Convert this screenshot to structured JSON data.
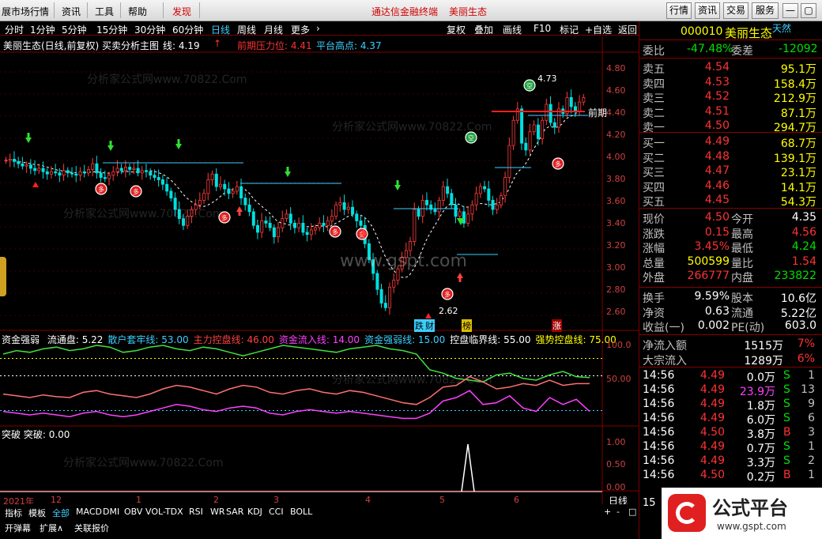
{
  "menu": {
    "items": [
      "展市场行情",
      "资讯",
      "工具",
      "帮助"
    ],
    "discover": "发现",
    "title_app": "通达信金融终端",
    "title_stock": "美丽生态",
    "right_buttons": [
      "行情",
      "资讯",
      "交易",
      "服务"
    ],
    "win_buttons": [
      "◯",
      "—",
      "▢",
      "✕"
    ]
  },
  "periods": {
    "items": [
      "分时",
      "1分钟",
      "5分钟",
      "15分钟",
      "30分钟",
      "60分钟",
      "日线",
      "周线",
      "月线",
      "更多",
      "›"
    ],
    "active": "日线",
    "tools": [
      "复权",
      "叠加",
      "画线",
      "F10",
      "标记",
      "+自选",
      "返回"
    ]
  },
  "chart_header": {
    "title": "美丽生态(日线,前复权) 买卖分析主图",
    "line_label": "线: 4.19",
    "line_arrow": "↑",
    "pressure": "前期压力位: 4.41",
    "platform": "平台高点: 4.37"
  },
  "indicator1": {
    "name": "资金强弱",
    "items": [
      {
        "label": "流通盘: 5.22",
        "color": "#ffffff"
      },
      {
        "label": "散户套牢线: 53.00",
        "color": "#3ccfff"
      },
      {
        "label": "主力控盘线: 46.00",
        "color": "#ff4040"
      },
      {
        "label": "资金流入线: 14.00",
        "color": "#ff40ff"
      },
      {
        "label": "资金强弱线: 15.00",
        "color": "#3ccfff"
      },
      {
        "label": "控盘临界线: 55.00",
        "color": "#ffffff"
      },
      {
        "label": "强势控盘线: 75.00",
        "color": "#ffff00"
      }
    ]
  },
  "indicator2": {
    "name": "突破",
    "value": "突破: 0.00"
  },
  "axis_main": [
    "4.80",
    "4.60",
    "4.40",
    "4.20",
    "4.00",
    "3.80",
    "3.60",
    "3.40",
    "3.20",
    "3.00",
    "2.80",
    "2.60"
  ],
  "axis_ind1": [
    "100.0",
    "50.00"
  ],
  "axis_ind2": [
    "1.00",
    "0.50",
    "0.00"
  ],
  "markers": {
    "high": "4.73",
    "low": "2.62",
    "front": "前期",
    "tags": [
      "跌",
      "财",
      "榜",
      "涨"
    ]
  },
  "time_axis": [
    "2021年",
    "12",
    "1",
    "2",
    "3",
    "4",
    "5",
    "6"
  ],
  "period_label": "日线",
  "bottom_tabs": [
    "指标",
    "模板",
    "全部",
    "MACD",
    "DMI",
    "OBV",
    "VOL-TDX",
    "RSI",
    "WR",
    "SAR",
    "KDJ",
    "CCI",
    "BOLL"
  ],
  "bottom_tabs_active": "全部",
  "bottom_row2": [
    "开弹幕",
    "扩展∧",
    "关联报价"
  ],
  "watermark": "分析家公式网www.70822.Com",
  "watermark2": "www.gspt.com",
  "quote": {
    "code": "000010",
    "name": "美丽生态",
    "tag": "天然",
    "weibi_label": "委比",
    "weibi": "-47.48%",
    "weicha_label": "委差",
    "weicha": "-12092",
    "sell": [
      {
        "label": "卖五",
        "price": "4.54",
        "vol": "95.1万"
      },
      {
        "label": "卖四",
        "price": "4.53",
        "vol": "158.4万"
      },
      {
        "label": "卖三",
        "price": "4.52",
        "vol": "212.9万"
      },
      {
        "label": "卖二",
        "price": "4.51",
        "vol": "87.1万"
      },
      {
        "label": "卖一",
        "price": "4.50",
        "vol": "294.7万"
      }
    ],
    "buy": [
      {
        "label": "买一",
        "price": "4.49",
        "vol": "68.7万"
      },
      {
        "label": "买二",
        "price": "4.48",
        "vol": "139.1万"
      },
      {
        "label": "买三",
        "price": "4.47",
        "vol": "23.1万"
      },
      {
        "label": "买四",
        "price": "4.46",
        "vol": "14.1万"
      },
      {
        "label": "买五",
        "price": "4.45",
        "vol": "54.3万"
      }
    ],
    "stats": [
      {
        "l1": "现价",
        "v1": "4.50",
        "c1": "red",
        "l2": "今开",
        "v2": "4.35",
        "c2": "white"
      },
      {
        "l1": "涨跌",
        "v1": "0.15",
        "c1": "red",
        "l2": "最高",
        "v2": "4.56",
        "c2": "red"
      },
      {
        "l1": "涨幅",
        "v1": "3.45%",
        "c1": "red",
        "l2": "最低",
        "v2": "4.24",
        "c2": "green"
      },
      {
        "l1": "总量",
        "v1": "500599",
        "c1": "yellow",
        "l2": "量比",
        "v2": "1.54",
        "c2": "red"
      },
      {
        "l1": "外盘",
        "v1": "266777",
        "c1": "red",
        "l2": "内盘",
        "v2": "233822",
        "c2": "green"
      }
    ],
    "stats2": [
      {
        "l1": "换手",
        "v1": "9.59%",
        "l2": "股本",
        "v2": "10.6亿"
      },
      {
        "l1": "净资",
        "v1": "0.63",
        "l2": "流通",
        "v2": "5.22亿"
      },
      {
        "l1": "收益(一)",
        "v1": "0.002",
        "l2": "PE(动)",
        "v2": "603.0"
      }
    ],
    "flow": [
      {
        "label": "净流入额",
        "value": "1515万",
        "pct": "7%"
      },
      {
        "label": "大宗流入",
        "value": "1289万",
        "pct": "6%"
      }
    ],
    "ticks": [
      {
        "t": "14:56",
        "p": "4.49",
        "v": "0.0万",
        "s": "S",
        "n": "1",
        "vc": "#ffffff"
      },
      {
        "t": "14:56",
        "p": "4.49",
        "v": "23.9万",
        "s": "S",
        "n": "13",
        "vc": "#ff40ff"
      },
      {
        "t": "14:56",
        "p": "4.49",
        "v": "1.8万",
        "s": "S",
        "n": "9",
        "vc": "#ffffff"
      },
      {
        "t": "14:56",
        "p": "4.49",
        "v": "6.0万",
        "s": "S",
        "n": "6",
        "vc": "#ffffff"
      },
      {
        "t": "14:56",
        "p": "4.50",
        "v": "3.8万",
        "s": "B",
        "n": "3",
        "vc": "#ffffff"
      },
      {
        "t": "14:56",
        "p": "4.49",
        "v": "0.7万",
        "s": "S",
        "n": "1",
        "vc": "#ffffff"
      },
      {
        "t": "14:56",
        "p": "4.49",
        "v": "3.3万",
        "s": "S",
        "n": "2",
        "vc": "#ffffff"
      },
      {
        "t": "14:56",
        "p": "4.50",
        "v": "0.2万",
        "s": "B",
        "n": "1",
        "vc": "#ffffff"
      }
    ],
    "tick_last_time": "15"
  },
  "logo": {
    "text": "公式平台",
    "url": "www.gspt.com"
  }
}
